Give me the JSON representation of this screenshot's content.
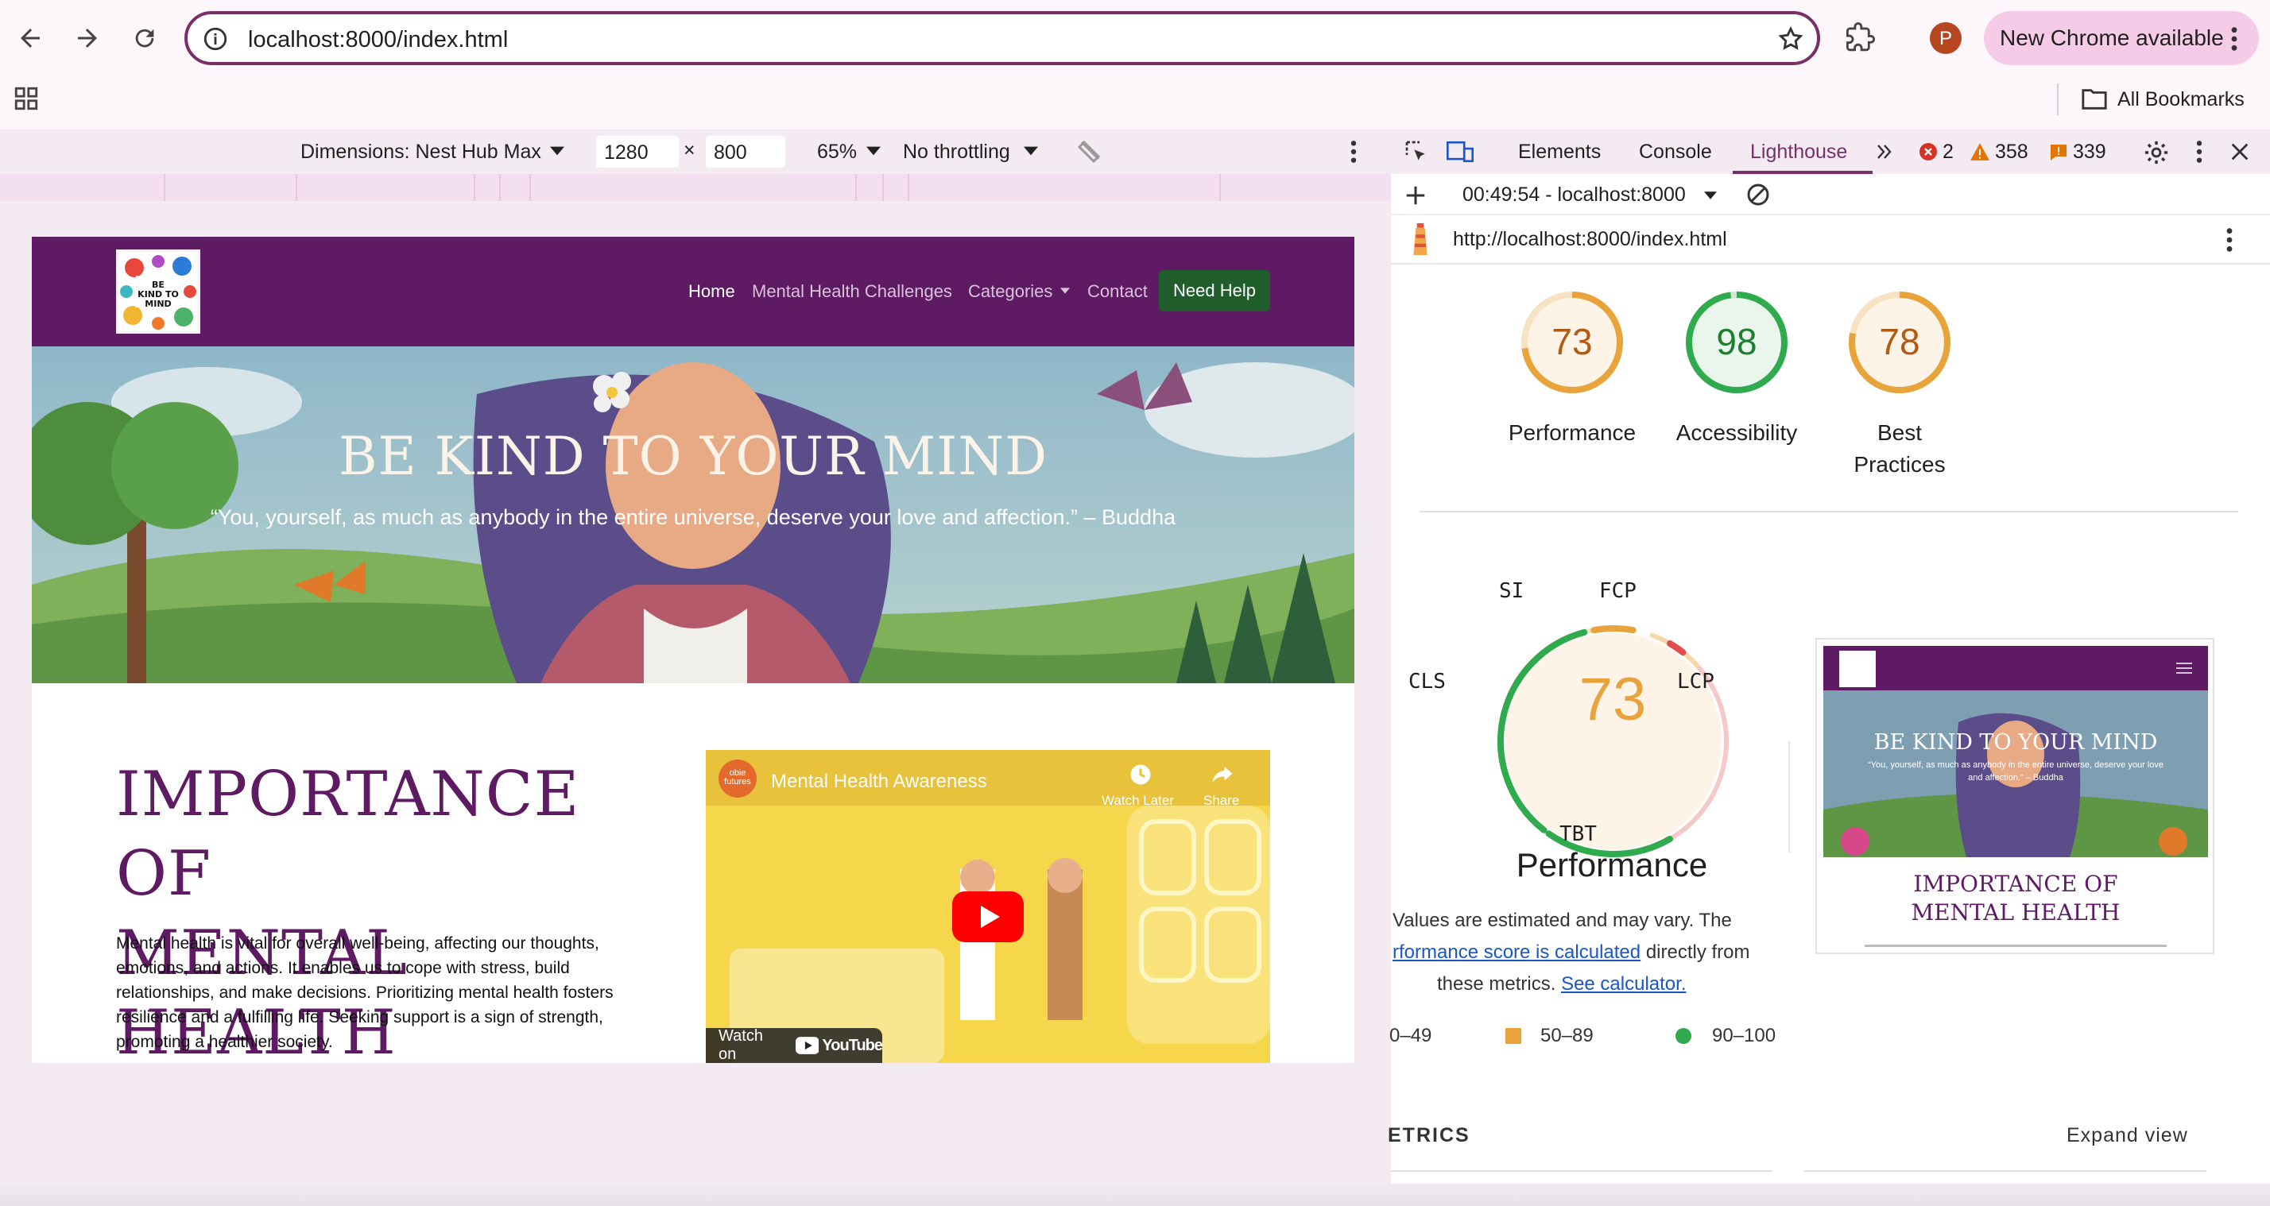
{
  "browser": {
    "url": "localhost:8000/index.html",
    "profile_initial": "P",
    "update_label": "New Chrome available",
    "bookmarks_label": "All Bookmarks",
    "colors": {
      "accent": "#7a2e67",
      "pill": "#f5cbe7"
    }
  },
  "device_toolbar": {
    "dimensions": "Dimensions: Nest Hub Max",
    "width": "1280",
    "times": "×",
    "height": "800",
    "zoom": "65%",
    "throttling": "No throttling"
  },
  "site": {
    "logo_text": "BE KIND TO MIND",
    "nav": {
      "home": "Home",
      "challenges": "Mental Health Challenges",
      "categories": "Categories",
      "contact": "Contact",
      "need_help": "Need Help"
    },
    "hero": {
      "title": "BE KIND TO YOUR MIND",
      "quote": "“You, yourself, as much as anybody in the entire universe, deserve your love and affection.” – Buddha"
    },
    "importance": {
      "title_line1": "IMPORTANCE OF",
      "title_line2": "MENTAL HEALTH",
      "text": "Mental health is vital for overall well-being, affecting our thoughts, emotions, and actions. It enables us to cope with stress, build relationships, and make decisions. Prioritizing mental health fosters resilience and a fulfilling life. Seeking support is a sign of strength, promoting a healthier society."
    },
    "video": {
      "channel_badge": "obie futures",
      "title": "Mental Health Awareness",
      "watch_later": "Watch Later",
      "share": "Share",
      "watch_on": "Watch on",
      "youtube": "YouTube"
    },
    "colors": {
      "nav": "#5e1a62",
      "button": "#1f5e2b"
    }
  },
  "devtools": {
    "tabs": {
      "elements": "Elements",
      "console": "Console",
      "lighthouse": "Lighthouse"
    },
    "counts": {
      "errors": "2",
      "warnings": "358",
      "issues": "339"
    },
    "report_time": "00:49:54 - localhost:8000",
    "report_url": "http://localhost:8000/index.html",
    "scores": [
      {
        "label_line1": "Performance",
        "label_line2": "",
        "score": "73",
        "value": 73,
        "color": "#e8a33a"
      },
      {
        "label_line1": "Accessibility",
        "label_line2": "",
        "score": "98",
        "value": 98,
        "color": "#2faa4c"
      },
      {
        "label_line1": "Best",
        "label_line2": "Practices",
        "score": "78",
        "value": 78,
        "color": "#e8a33a"
      }
    ],
    "perf": {
      "score": "73",
      "title": "Performance",
      "metrics": {
        "si": "SI",
        "fcp": "FCP",
        "lcp": "LCP",
        "tbt": "TBT",
        "cls": "CLS"
      },
      "note_line1": "Values are estimated and may vary. The",
      "note_link1": "rformance score is calculated",
      "note_mid": "directly from",
      "note_line3": "these metrics.",
      "note_link2": "See calculator."
    },
    "legend": {
      "red": "0–49",
      "orange": "50–89",
      "green": "90–100"
    },
    "metrics_header": "ETRICS",
    "expand_view": "Expand view",
    "thumbnail": {
      "hero_title": "BE KIND TO YOUR MIND",
      "hero_quote": "“You, yourself, as much as anybody in the entire universe, deserve your love and affection.” – Buddha",
      "section_title": "IMPORTANCE OF MENTAL HEALTH"
    }
  }
}
